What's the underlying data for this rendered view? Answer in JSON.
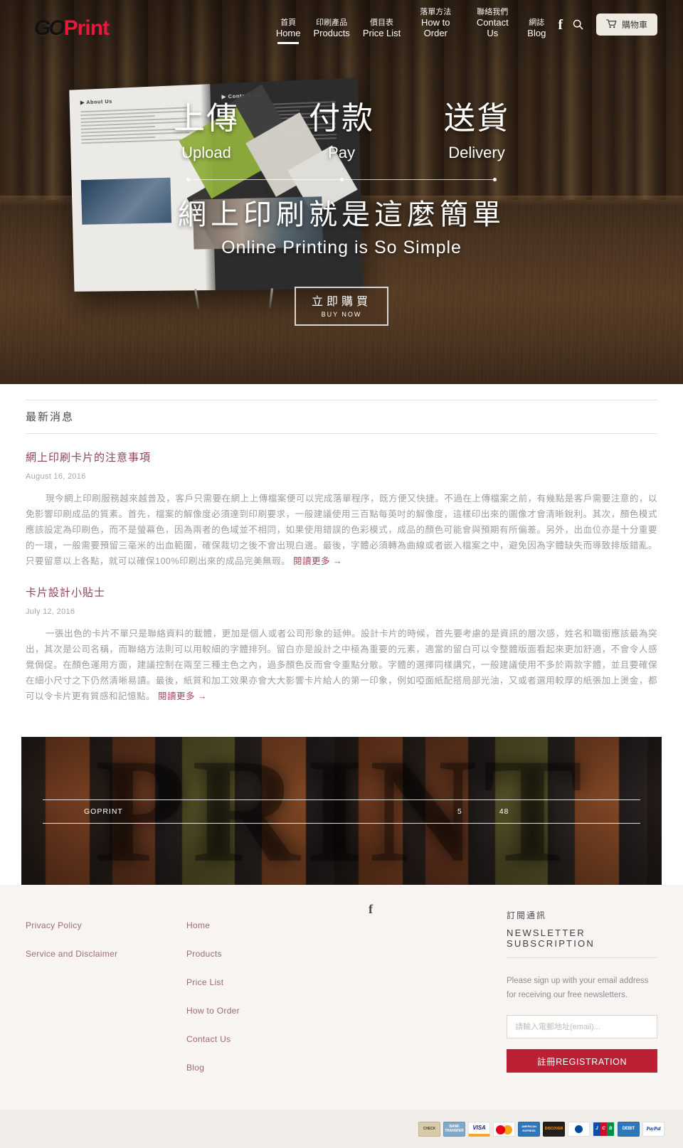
{
  "header": {
    "logo": {
      "part1": "GO",
      "part2": "Print"
    },
    "nav": [
      {
        "cn": "首頁",
        "en": "Home",
        "active": true
      },
      {
        "cn": "印刷產品",
        "en": "Products",
        "active": false
      },
      {
        "cn": "價目表",
        "en": "Price List",
        "active": false
      },
      {
        "cn": "落單方法",
        "en": "How to Order",
        "active": false
      },
      {
        "cn": "聯絡我們",
        "en": "Contact Us",
        "active": false
      },
      {
        "cn": "網誌",
        "en": "Blog",
        "active": false
      }
    ],
    "facebook_icon": "facebook-icon",
    "search_icon": "search-icon",
    "cart": {
      "icon": "cart-icon",
      "label": "購物車"
    }
  },
  "hero": {
    "steps": [
      {
        "cn": "上傳",
        "en": "Upload"
      },
      {
        "cn": "付款",
        "en": "Pay"
      },
      {
        "cn": "送貨",
        "en": "Delivery"
      }
    ],
    "tagline_cn": "網上印刷就是這麼簡單",
    "tagline_en": "Online  Printing  is  So  Simple",
    "cta": {
      "cn": "立即購買",
      "en": "BUY NOW"
    }
  },
  "blog": {
    "section_title": "最新消息",
    "posts": [
      {
        "title": "網上印刷卡片的注意事項",
        "date": "August 16, 2016",
        "body": "現今網上印刷服務越來越普及，客戶只需要在網上上傳檔案便可以完成落單程序，既方便又快捷。不過在上傳檔案之前，有幾點是客戶需要注意的，以免影響印刷成品的質素。首先，檔案的解像度必須達到印刷要求，一般建議使用三百點每英吋的解像度，這樣印出來的圖像才會清晰銳利。其次，顏色模式應該設定為印刷色，而不是螢幕色，因為兩者的色域並不相同，如果使用錯誤的色彩模式，成品的顏色可能會與預期有所偏差。另外，出血位亦是十分重要的一環，一般需要預留三毫米的出血範圍，確保裁切之後不會出現白邊。最後，字體必須轉為曲線或者嵌入檔案之中，避免因為字體缺失而導致排版錯亂。只要留意以上各點，就可以確保",
        "body_highlight": "100%",
        "body_tail": "印刷出來的成品完美無瑕。",
        "readmore": "閱讀更多"
      },
      {
        "title": "卡片設計小貼士",
        "date": "July 12, 2016",
        "body": "一張出色的卡片不單只是聯絡資料的載體，更加是個人或者公司形象的延伸。設計卡片的時候，首先要考慮的是資訊的層次感，姓名和職銜應該最為突出，其次是公司名稱，而聯絡方法則可以用較細的字體排列。留白亦是設計之中極為重要的元素，適當的留白可以令整體版面看起來更加舒適，不會令人感覺侷促。在顏色運用方面，建議控制在兩至三種主色之內，過多顏色反而會令重點分散。字體的選擇同樣講究，一般建議使用不多於兩款字體，並且要確保在細小尺寸之下仍然清晰易讀。最後，紙質和加工效果亦會大大影響卡片給人的第一印象，例如啞面紙配搭局部光油，又或者選用較厚的紙張加上燙金，都可以令卡片更有質感和記憶點。",
        "readmore": "閱讀更多"
      }
    ]
  },
  "banner": {
    "letters": "PRINT",
    "stats": [
      {
        "label": "GOPRINT"
      },
      {
        "label": "5"
      },
      {
        "label": "48"
      }
    ]
  },
  "footer": {
    "col1": [
      {
        "label": "Privacy Policy"
      },
      {
        "label": "Service and Disclaimer"
      }
    ],
    "col2": [
      {
        "label": "Home"
      },
      {
        "label": "Products"
      },
      {
        "label": "Price List"
      },
      {
        "label": "How to Order"
      },
      {
        "label": "Contact Us"
      },
      {
        "label": "Blog"
      }
    ],
    "social": {
      "icon": "facebook-icon",
      "glyph": "f"
    },
    "newsletter": {
      "title_cn": "訂閱通訊",
      "title_en": "NEWSLETTER SUBSCRIPTION",
      "description": "Please sign up with your email address for receiving our free newsletters.",
      "placeholder": "請輸入電郵地址(email)...",
      "button": "註冊REGISTRATION"
    }
  },
  "payments": [
    {
      "name": "check",
      "text": "CHECK"
    },
    {
      "name": "bank-transfer",
      "text": "BANK TRANSFER"
    },
    {
      "name": "visa",
      "text": "VISA"
    },
    {
      "name": "mastercard",
      "text": ""
    },
    {
      "name": "american-express",
      "text": "AMERICAN EXPRESS"
    },
    {
      "name": "discover",
      "text": "DISCOVER"
    },
    {
      "name": "diners-club",
      "text": ""
    },
    {
      "name": "jcb",
      "text": ""
    },
    {
      "name": "debit",
      "text": "DEBIT"
    },
    {
      "name": "paypal",
      "text": "PayPal"
    }
  ],
  "colors": {
    "brand_red": "#e8173d",
    "button_red": "#bc2035",
    "link_mauve": "#a06a76",
    "post_title": "#8f4452"
  }
}
